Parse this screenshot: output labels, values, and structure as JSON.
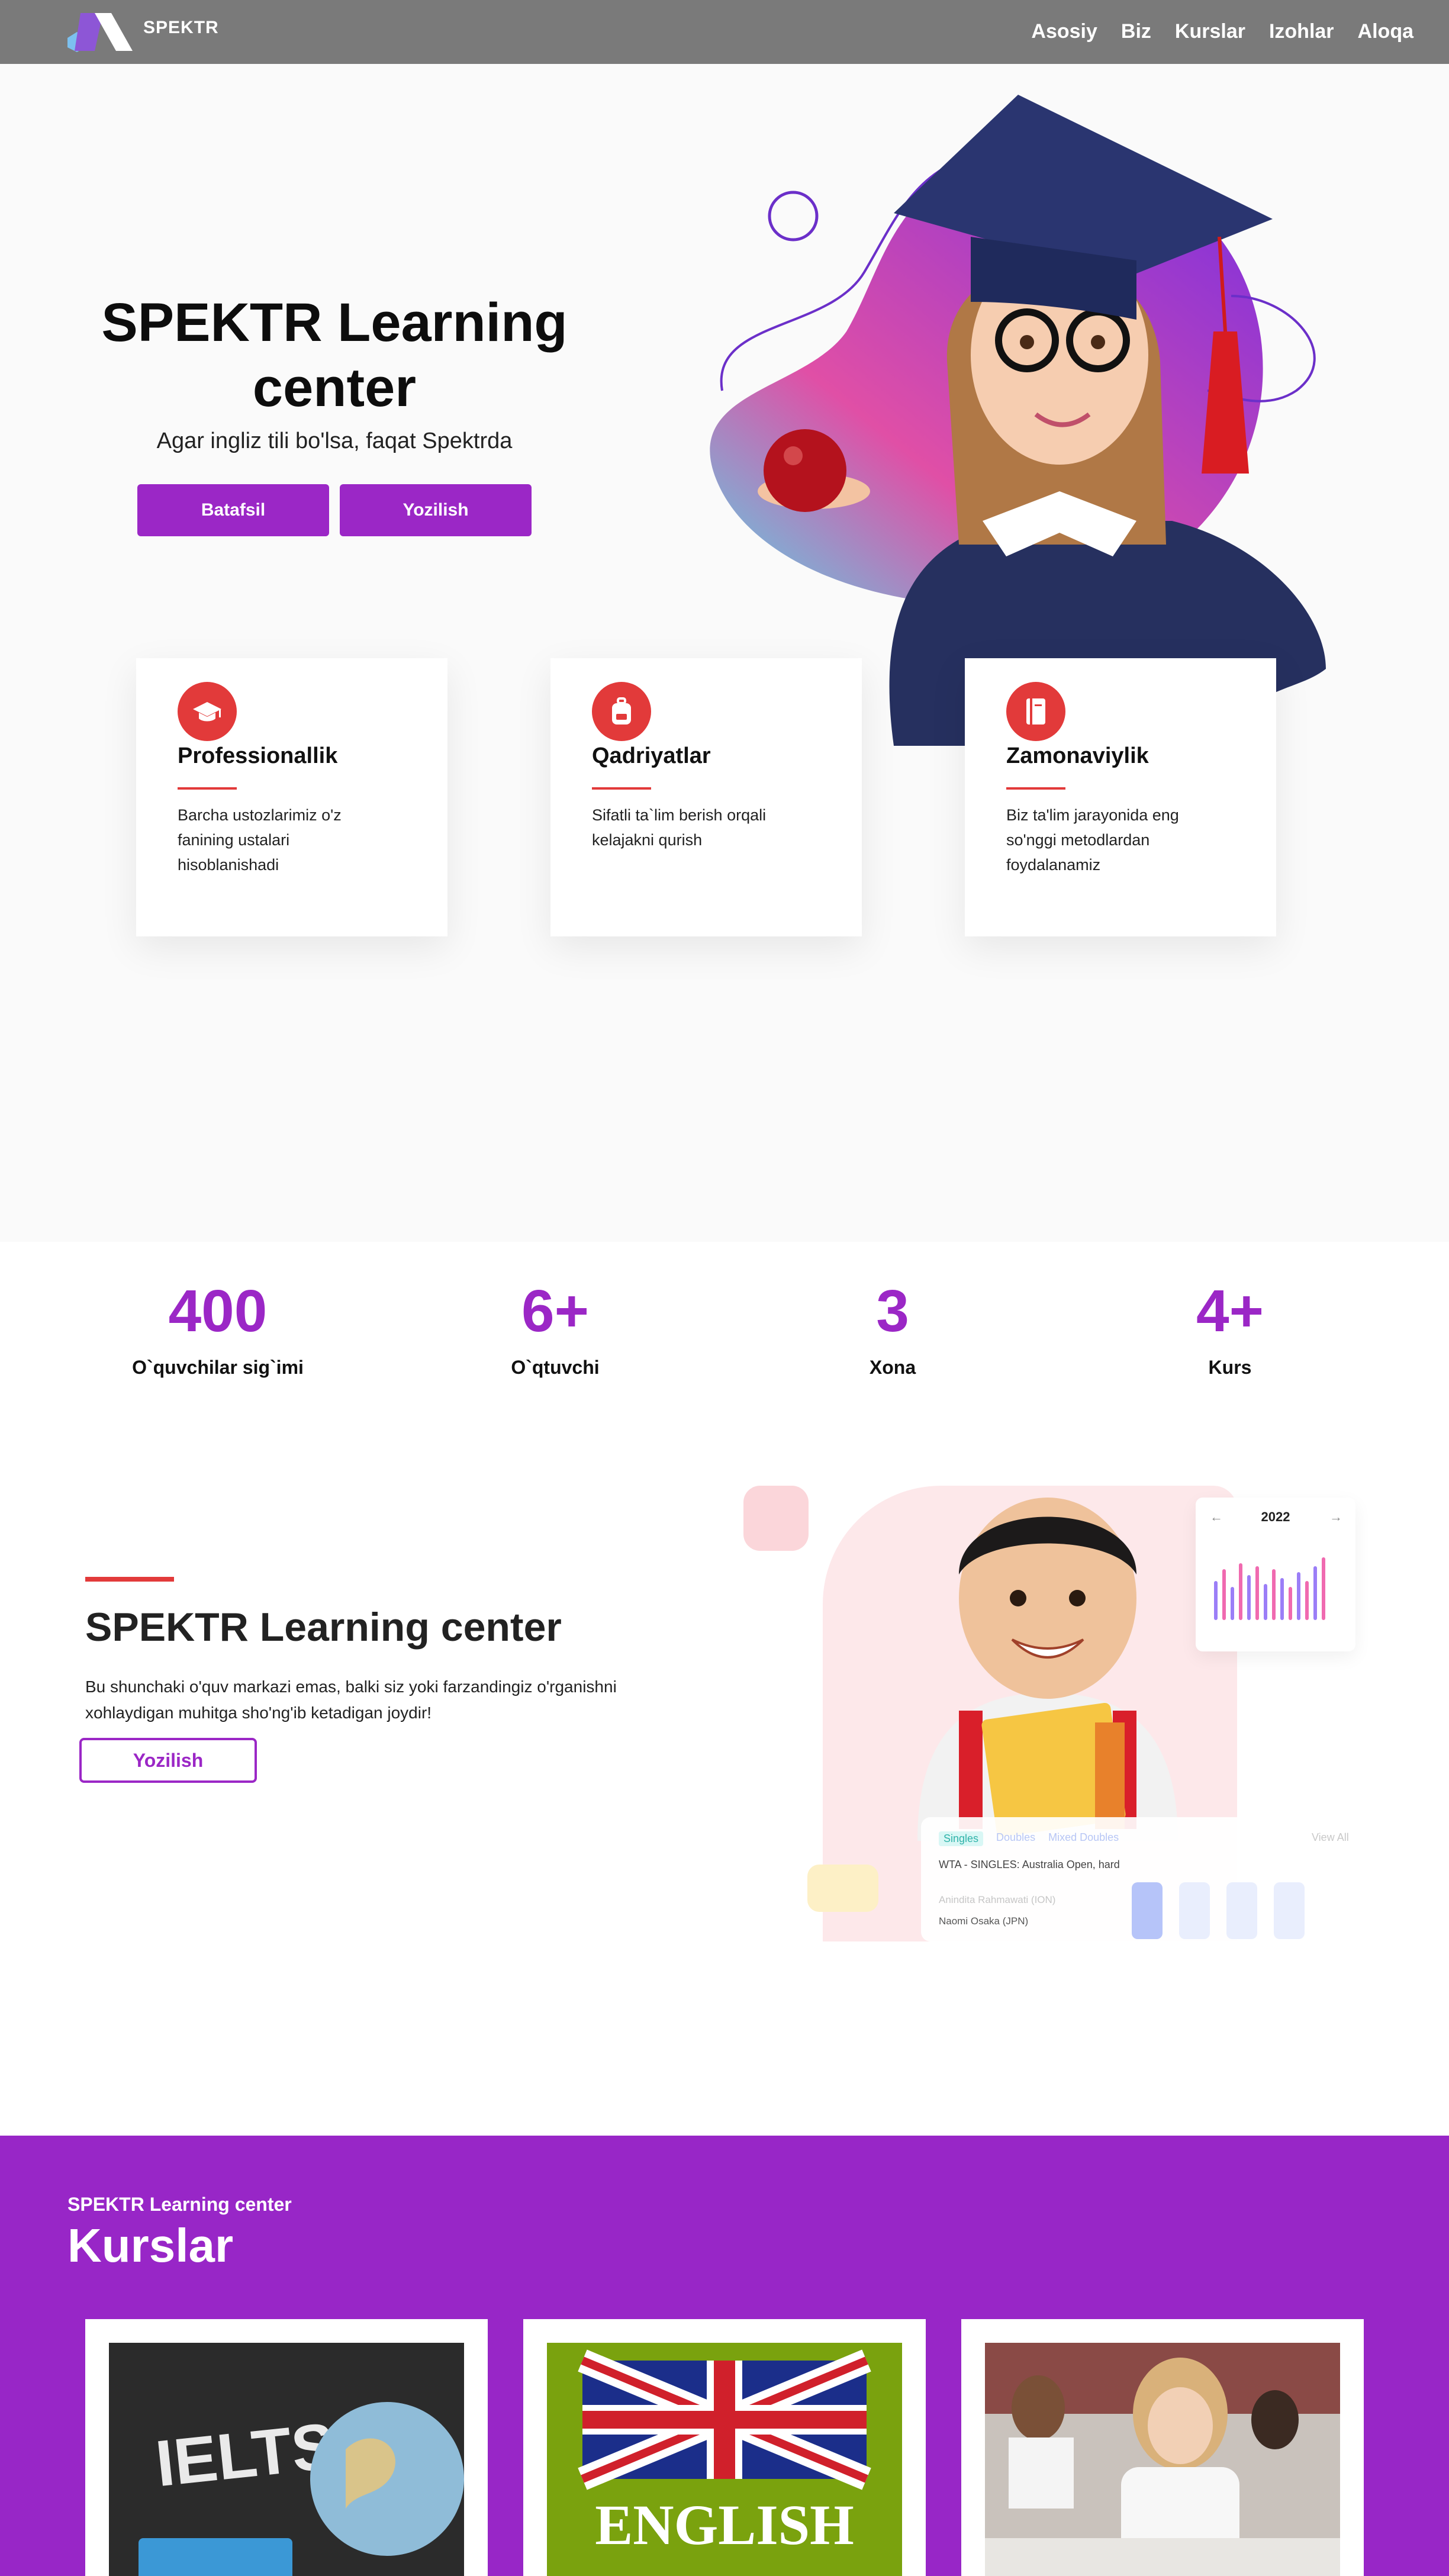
{
  "nav": {
    "brand": "SPEKTR",
    "links": [
      "Asosiy",
      "Biz",
      "Kurslar",
      "Izohlar",
      "Aloqa"
    ]
  },
  "hero": {
    "title": "SPEKTR Learning center",
    "subtitle": "Agar ingliz tili bo'lsa, faqat Spektrda",
    "btn_more": "Batafsil",
    "btn_enroll": "Yozilish"
  },
  "features": [
    {
      "icon": "graduation-cap-icon",
      "title": "Professionallik",
      "text": "Barcha ustozlarimiz o'z fanining ustalari hisoblanishadi"
    },
    {
      "icon": "backpack-icon",
      "title": "Qadriyatlar",
      "text": "Sifatli ta`lim berish orqali kelajakni qurish"
    },
    {
      "icon": "book-icon",
      "title": "Zamonaviylik",
      "text": "Biz ta'lim jarayonida eng so'nggi metodlardan foydalanamiz"
    }
  ],
  "stats": [
    {
      "value": "400",
      "label": "O`quvchilar sig`imi"
    },
    {
      "value": "6+",
      "label": "O`qtuvchi"
    },
    {
      "value": "3",
      "label": "Xona"
    },
    {
      "value": "4+",
      "label": "Kurs"
    }
  ],
  "about": {
    "title": "SPEKTR Learning center",
    "text": "Bu shunchaki o'quv markazi emas, balki siz yoki farzandingiz o'rganishni xohlaydigan muhitga sho'ng'ib ketadigan joydir!",
    "btn": "Yozilish",
    "widget_year": "2022",
    "widget_tabs": [
      "Singles",
      "Doubles",
      "Mixed Doubles"
    ],
    "widget_viewall": "View All",
    "widget_match": "WTA - SINGLES: Australia Open, hard",
    "widget_players": [
      "Anindita Rahmawati (ION)",
      "Naomi Osaka (JPN)"
    ]
  },
  "courses": {
    "subtitle": "SPEKTR Learning center",
    "title": "Kurslar",
    "items": [
      {
        "image": "ielts-chalkboard-globe",
        "label": "IELTS"
      },
      {
        "image": "uk-flag-english",
        "label": "ENGLISH"
      },
      {
        "image": "kids-classroom-writing"
      }
    ]
  },
  "colors": {
    "accent": "#9b27c6",
    "red": "#e23a3a",
    "nav": "#7a7a7a"
  }
}
